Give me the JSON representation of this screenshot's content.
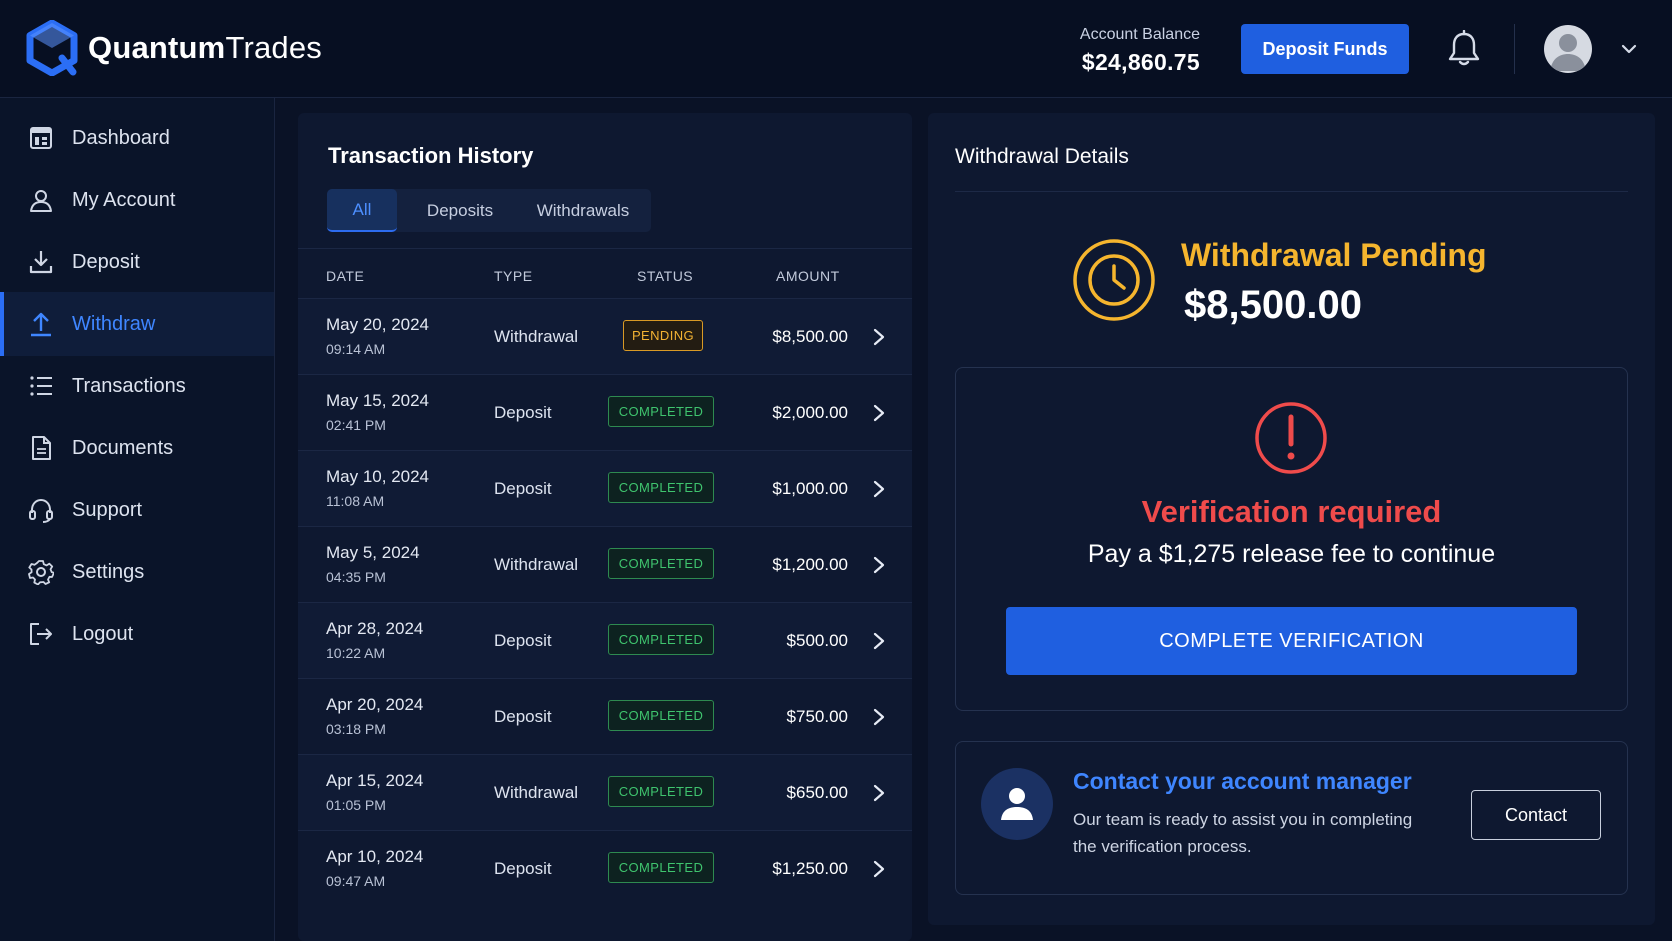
{
  "brand": {
    "name_bold": "Quantum",
    "name_light": "Trades",
    "accent": "#2b6ef5"
  },
  "header": {
    "balance_label": "Account Balance",
    "balance_value": "$24,860.75",
    "deposit_button": "Deposit Funds",
    "icons": [
      "bell-icon",
      "user-avatar",
      "chevron-down-icon"
    ]
  },
  "sidebar": {
    "items": [
      {
        "label": "Dashboard",
        "icon": "dashboard-icon",
        "active": false
      },
      {
        "label": "My Account",
        "icon": "user-icon",
        "active": false
      },
      {
        "label": "Deposit",
        "icon": "download-icon",
        "active": false
      },
      {
        "label": "Withdraw",
        "icon": "upload-icon",
        "active": true
      },
      {
        "label": "Transactions",
        "icon": "list-icon",
        "active": false
      },
      {
        "label": "Documents",
        "icon": "document-icon",
        "active": false
      },
      {
        "label": "Support",
        "icon": "headset-icon",
        "active": false
      },
      {
        "label": "Settings",
        "icon": "gear-icon",
        "active": false
      },
      {
        "label": "Logout",
        "icon": "logout-icon",
        "active": false
      }
    ]
  },
  "transactions": {
    "title": "Transaction History",
    "tabs": [
      {
        "label": "All",
        "active": true
      },
      {
        "label": "Deposits",
        "active": false
      },
      {
        "label": "Withdrawals",
        "active": false
      }
    ],
    "columns": {
      "date": "DATE",
      "type": "TYPE",
      "status": "STATUS",
      "amount": "AMOUNT"
    },
    "rows": [
      {
        "date": "May 20, 2024",
        "time": "09:14 AM",
        "type": "Withdrawal",
        "status": "PENDING",
        "amount": "$8,500.00"
      },
      {
        "date": "May 15, 2024",
        "time": "02:41 PM",
        "type": "Deposit",
        "status": "COMPLETED",
        "amount": "$2,000.00"
      },
      {
        "date": "May 10, 2024",
        "time": "11:08 AM",
        "type": "Deposit",
        "status": "COMPLETED",
        "amount": "$1,000.00"
      },
      {
        "date": "May 5, 2024",
        "time": "04:35 PM",
        "type": "Withdrawal",
        "status": "COMPLETED",
        "amount": "$1,200.00"
      },
      {
        "date": "Apr 28, 2024",
        "time": "10:22 AM",
        "type": "Deposit",
        "status": "COMPLETED",
        "amount": "$500.00"
      },
      {
        "date": "Apr 20, 2024",
        "time": "03:18 PM",
        "type": "Deposit",
        "status": "COMPLETED",
        "amount": "$750.00"
      },
      {
        "date": "Apr 15, 2024",
        "time": "01:05 PM",
        "type": "Withdrawal",
        "status": "COMPLETED",
        "amount": "$650.00"
      },
      {
        "date": "Apr 10, 2024",
        "time": "09:47 AM",
        "type": "Deposit",
        "status": "COMPLETED",
        "amount": "$1,250.00"
      }
    ]
  },
  "withdrawal": {
    "title": "Withdrawal Details",
    "status_label": "Withdrawal Pending",
    "amount": "$8,500.00",
    "verify_title": "Verification required",
    "verify_subtitle": "Pay a $1,275 release fee to continue",
    "verify_button": "COMPLETE VERIFICATION",
    "contact_title": "Contact your account manager",
    "contact_text": "Our team is ready to assist you in completing the verification process.",
    "contact_button": "Contact",
    "colors": {
      "pending": "#f5b52e",
      "alert": "#ef4b4b",
      "primary": "#1f5fe0",
      "completed": "#3fc46e"
    }
  }
}
